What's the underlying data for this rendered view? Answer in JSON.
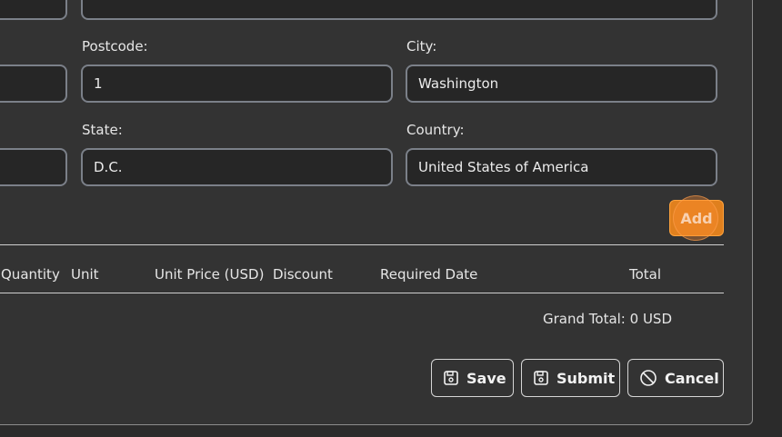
{
  "form": {
    "postcode": {
      "label": "Postcode:",
      "value": "1"
    },
    "city": {
      "label": "City:",
      "value": "Washington"
    },
    "state": {
      "label": "State:",
      "value": "D.C."
    },
    "country": {
      "label": "Country:",
      "value": "United States of America"
    }
  },
  "add_button": {
    "label": "Add"
  },
  "table": {
    "headers": [
      "Quantity",
      "Unit",
      "Unit Price (USD)",
      "Discount",
      "Required Date",
      "Total"
    ]
  },
  "grand_total": "Grand Total: 0 USD",
  "actions": {
    "save": "Save",
    "submit": "Submit",
    "cancel": "Cancel"
  },
  "colors": {
    "accent": "#e0801e",
    "background": "#333333",
    "field_border": "#7b8089"
  }
}
